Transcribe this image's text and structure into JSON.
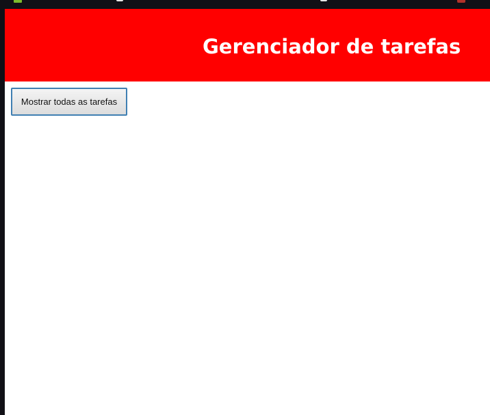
{
  "header": {
    "title": "Gerenciador de tarefas",
    "background_color": "#ff0000",
    "title_color": "#ffffff"
  },
  "actions": {
    "show_all_label": "Mostrar todas as tarefas"
  },
  "colors": {
    "app_background": "#ffffff",
    "window_chrome": "#111016",
    "button_border": "#3f7fb2"
  }
}
